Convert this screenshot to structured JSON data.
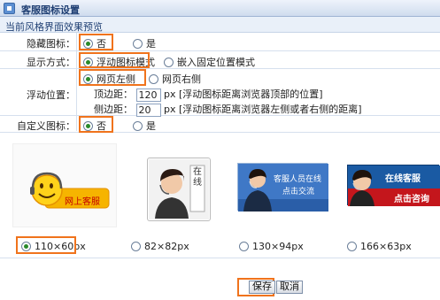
{
  "window": {
    "title": "客服图标设置"
  },
  "section": {
    "title": "当前风格界面效果预览"
  },
  "hide_icon": {
    "label": "隐藏图标：",
    "options": [
      "否",
      "是"
    ],
    "selected": "否"
  },
  "display_mode": {
    "label": "显示方式：",
    "options": [
      "浮动图标模式",
      "嵌入固定位置模式"
    ],
    "selected": "浮动图标模式"
  },
  "float_position": {
    "label": "浮动位置：",
    "options": [
      "网页左侧",
      "网页右侧"
    ],
    "selected": "网页左侧",
    "top": {
      "label": "顶边距：",
      "value": "120",
      "unit": "px",
      "hint": "[浮动图标距离浏览器顶部的位置]"
    },
    "side": {
      "label": "侧边距：",
      "value": "20",
      "unit": "px",
      "hint": "[浮动图标距离浏览器左侧或者右侧的距离]"
    }
  },
  "custom_icon": {
    "label": "自定义图标：",
    "options": [
      "否",
      "是"
    ],
    "selected": "否"
  },
  "icons": [
    {
      "text": "网上客服",
      "size": "110×60px",
      "selected": true
    },
    {
      "text": "在线",
      "size": "82×82px",
      "selected": false
    },
    {
      "text_line1": "客服人员在线",
      "text_line2": "点击交流",
      "size": "130×94px",
      "selected": false
    },
    {
      "text_line1": "在线客服",
      "text_line2": "点击咨询",
      "size": "166×63px",
      "selected": false
    }
  ],
  "buttons": {
    "save": "保存",
    "cancel": "取消"
  },
  "colors": {
    "highlight": "#f0731c",
    "title": "#1f3f73",
    "selected_dot": "#2a8a2a"
  }
}
